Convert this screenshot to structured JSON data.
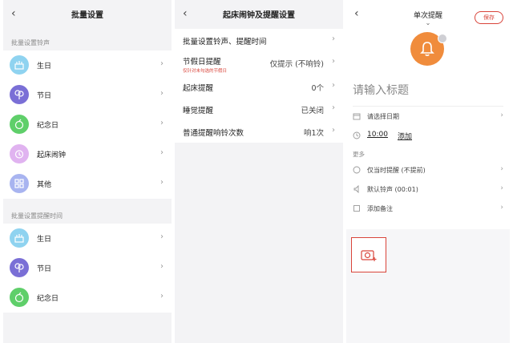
{
  "panel1": {
    "title": "批量设置",
    "back_glyph": "‹",
    "section_ringtone": "批量设置铃声",
    "ringtone_items": [
      {
        "label": "生日",
        "icon": "cake-icon",
        "color": "#8fd3f0"
      },
      {
        "label": "节日",
        "icon": "balloon-icon",
        "color": "#7a6fd6"
      },
      {
        "label": "纪念日",
        "icon": "anniversary-icon",
        "color": "#5fcf6a"
      },
      {
        "label": "起床闹钟",
        "icon": "alarm-clock-icon",
        "color": "#e0b3f0"
      },
      {
        "label": "其他",
        "icon": "grid-icon",
        "color": "#a8b4f0"
      }
    ],
    "section_time": "批量设置提醒时间",
    "time_items": [
      {
        "label": "生日",
        "icon": "cake-icon",
        "color": "#8fd3f0"
      },
      {
        "label": "节日",
        "icon": "balloon-icon",
        "color": "#7a6fd6"
      },
      {
        "label": "纪念日",
        "icon": "anniversary-icon",
        "color": "#5fcf6a"
      }
    ]
  },
  "panel2": {
    "title": "起床闹钟及提醒设置",
    "back_glyph": "‹",
    "rows": [
      {
        "label": "批量设置铃声、提醒时间",
        "value": ""
      },
      {
        "label": "节假日提醒",
        "sub": "仅针对未勾选的节假日",
        "value": "仅提示 (不响铃)"
      },
      {
        "label": "起床提醒",
        "value": "0个"
      },
      {
        "label": "睡觉提醒",
        "value": "已关闭"
      },
      {
        "label": "普通提醒响铃次数",
        "value": "响1次"
      }
    ]
  },
  "panel3": {
    "title": "单次提醒",
    "back_glyph": "‹",
    "chevron_glyph": "⌄",
    "save_label": "保存",
    "title_placeholder": "请输入标题",
    "date_placeholder": "请选择日期",
    "time_value": "10:00",
    "add_label": "添加",
    "more_label": "更多",
    "options": [
      {
        "label": "仅当时提醒 (不提前)",
        "icon": "reminder-icon"
      },
      {
        "label": "默认铃声 (00:01)",
        "icon": "ringtone-icon"
      },
      {
        "label": "添加备注",
        "icon": "note-icon"
      }
    ],
    "accent": "#d9443a",
    "bell_color": "#f08c3c"
  }
}
